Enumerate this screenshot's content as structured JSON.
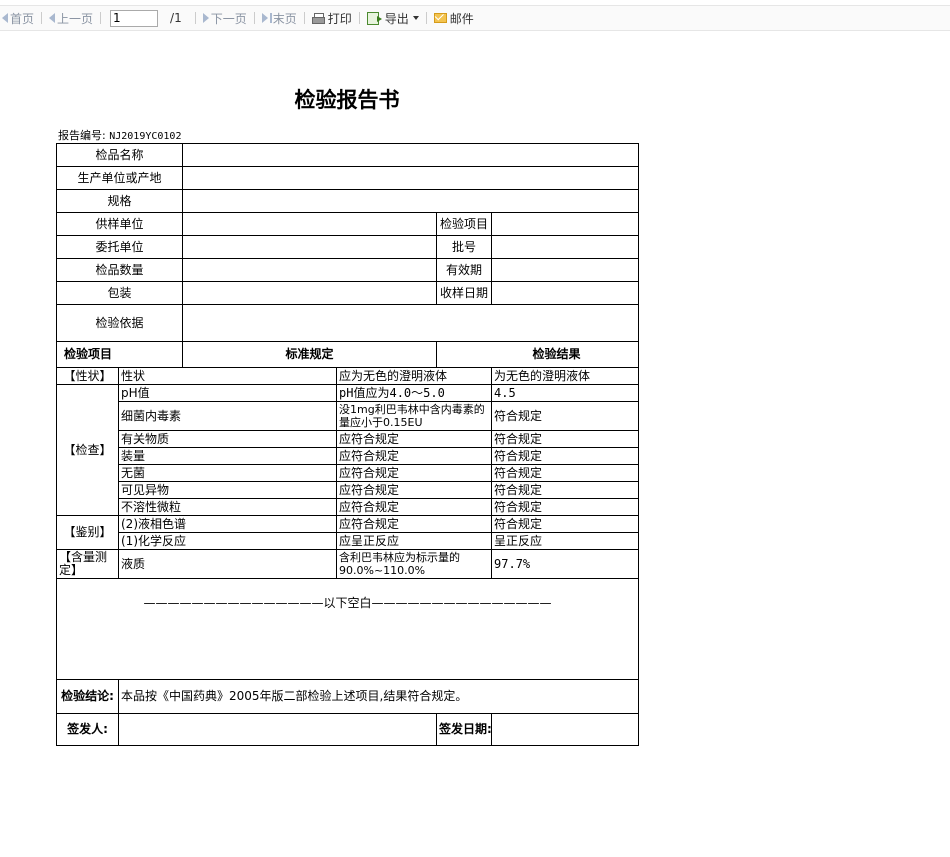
{
  "toolbar": {
    "first": "首页",
    "prev": "上一页",
    "page_value": "1",
    "page_total": "/1",
    "next": "下一页",
    "last": "末页",
    "print": "打印",
    "export": "导出",
    "mail": "邮件"
  },
  "report": {
    "title": "检验报告书",
    "number_label": "报告编号:",
    "number_value": "NJ2019YC0102",
    "info": {
      "sample_name": "检品名称",
      "producer": "生产单位或产地",
      "spec": "规格",
      "supplier": "供样单位",
      "test_item": "检验项目",
      "client": "委托单位",
      "batch": "批号",
      "quantity": "检品数量",
      "validity": "有效期",
      "package": "包装",
      "receive_date": "收样日期",
      "basis": "检验依据"
    },
    "headers": {
      "item": "检验项目",
      "standard": "标准规定",
      "result": "检验结果"
    },
    "groups": {
      "character": "【性状】",
      "check": "【检查】",
      "identify": "【鉴别】",
      "assay": "【含量测定】"
    },
    "rows": [
      {
        "name": "性状",
        "standard": "应为无色的澄明液体",
        "result": "为无色的澄明液体"
      },
      {
        "name": "pH值",
        "standard": "pH值应为4.0～5.0",
        "result": "4.5"
      },
      {
        "name": "细菌内毒素",
        "standard": "没1mg利巴韦林中含内毒素的量应小于0.15EU",
        "result": "符合规定"
      },
      {
        "name": "有关物质",
        "standard": "应符合规定",
        "result": "符合规定"
      },
      {
        "name": "装量",
        "standard": "应符合规定",
        "result": "符合规定"
      },
      {
        "name": "无菌",
        "standard": "应符合规定",
        "result": "符合规定"
      },
      {
        "name": "可见异物",
        "standard": "应符合规定",
        "result": "符合规定"
      },
      {
        "name": "不溶性微粒",
        "standard": "应符合规定",
        "result": "符合规定"
      },
      {
        "name": "(2)液相色谱",
        "standard": "应符合规定",
        "result": "符合规定"
      },
      {
        "name": "(1)化学反应",
        "standard": "应呈正反应",
        "result": "呈正反应"
      },
      {
        "name": "液质",
        "standard": "含利巴韦林应为标示量的90.0%~110.0%",
        "result": "97.7%"
      }
    ],
    "blank_line": "———————————————以下空白———————————————",
    "conclusion_label": "检验结论:",
    "conclusion_text": "本品按《中国药典》2005年版二部检验上述项目,结果符合规定。",
    "signer_label": "签发人:",
    "sign_date_label": "签发日期:"
  }
}
